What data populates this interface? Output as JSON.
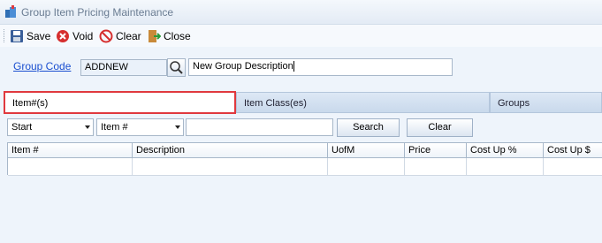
{
  "window": {
    "title": "Group Item Pricing Maintenance"
  },
  "toolbar": {
    "save_label": "Save",
    "void_label": "Void",
    "clear_label": "Clear",
    "close_label": "Close"
  },
  "form": {
    "group_code_label": "Group Code",
    "group_code_value": "ADDNEW",
    "description_value": "New Group Description"
  },
  "tabs": [
    {
      "label": "Item#(s)"
    },
    {
      "label": "Item Class(es)"
    },
    {
      "label": "Groups"
    }
  ],
  "filter": {
    "match_value": "Start",
    "field_value": "Item #",
    "search_text": "",
    "search_button": "Search",
    "clear_button": "Clear"
  },
  "grid": {
    "columns": [
      "Item #",
      "Description",
      "UofM",
      "Price",
      "Cost Up %",
      "Cost Up $"
    ]
  },
  "colors": {
    "active_tab_border": "#e0393e",
    "link": "#1a4fd0",
    "background": "#eef4fb"
  }
}
